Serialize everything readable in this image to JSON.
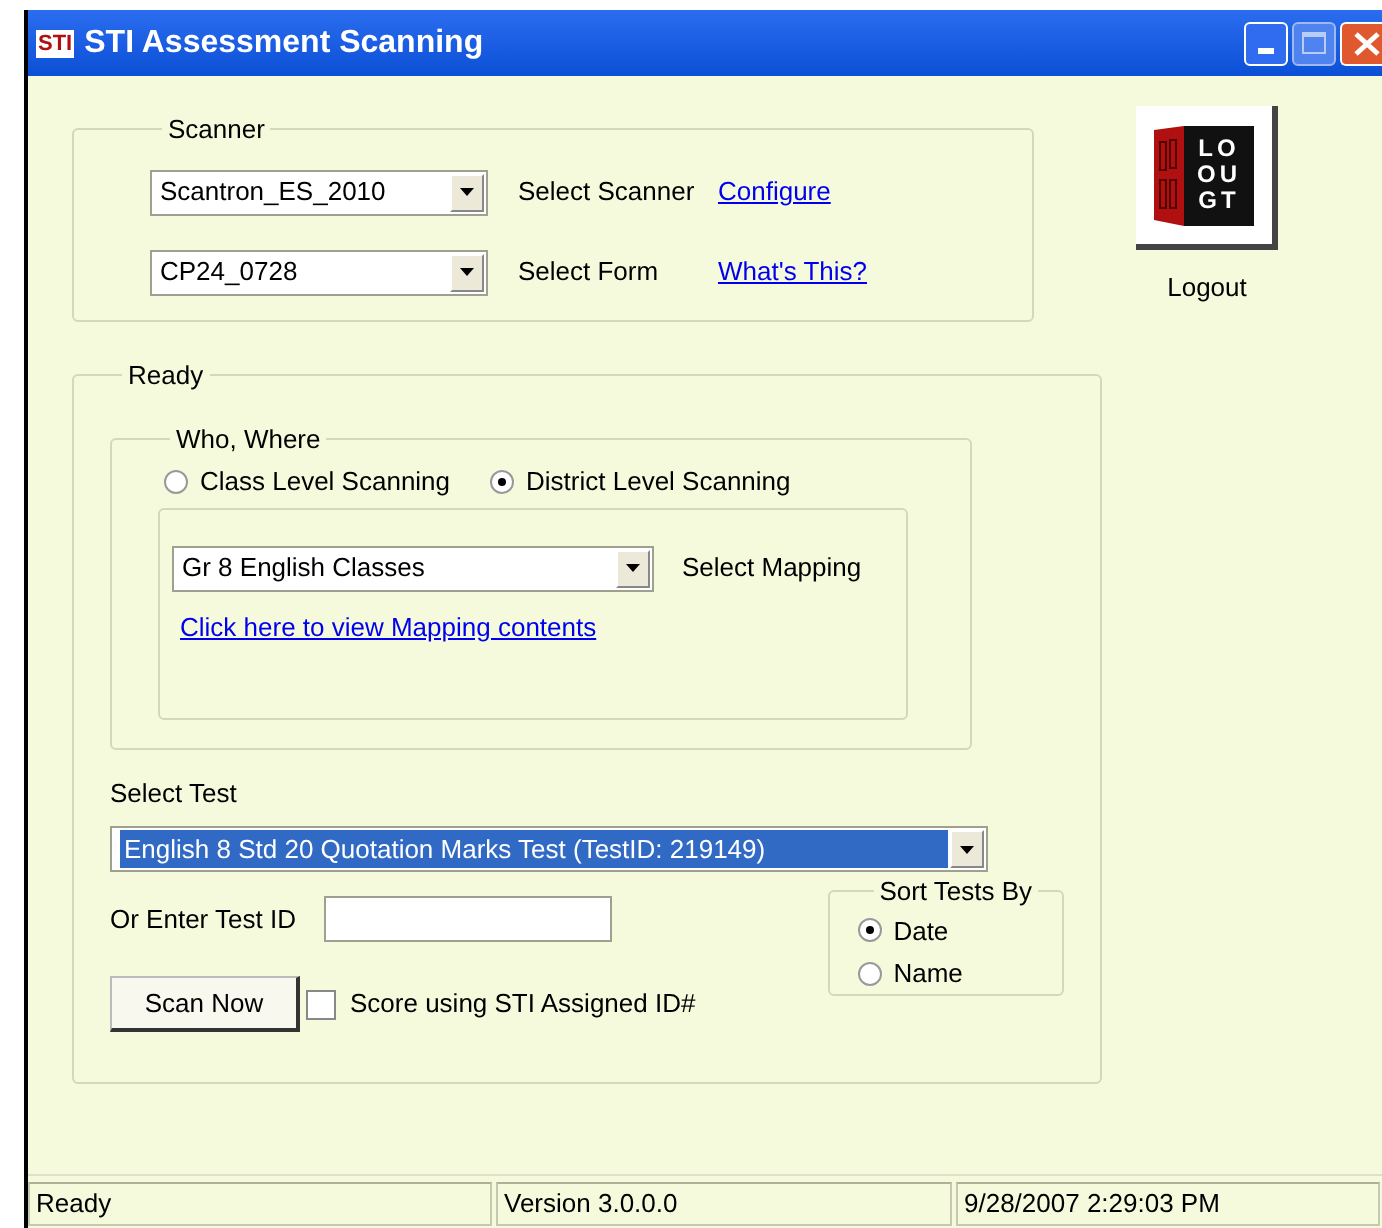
{
  "window": {
    "icon_text": "STI",
    "title": "STI Assessment Scanning"
  },
  "scanner": {
    "title": "Scanner",
    "rows": [
      {
        "value": "Scantron_ES_2010",
        "label": "Select Scanner",
        "link": "Configure"
      },
      {
        "value": "CP24_0728",
        "label": "Select Form",
        "link": "What's This?"
      }
    ]
  },
  "logout": {
    "icon_text": [
      "LO",
      "OU",
      "GT"
    ],
    "label": "Logout"
  },
  "ready": {
    "title": "Ready",
    "who_where": {
      "title": "Who, Where",
      "options": [
        {
          "label": "Class Level Scanning",
          "selected": false
        },
        {
          "label": "District Level Scanning",
          "selected": true
        }
      ],
      "mapping": {
        "value": "Gr 8 English Classes",
        "label": "Select Mapping",
        "link": "Click here to view Mapping contents"
      }
    },
    "select_test": {
      "label": "Select Test",
      "value": "English 8 Std 20 Quotation Marks Test  (TestID: 219149)"
    },
    "test_id": {
      "label": "Or Enter Test ID"
    },
    "sort": {
      "title": "Sort Tests By",
      "options": [
        {
          "label": "Date",
          "selected": true
        },
        {
          "label": "Name",
          "selected": false
        }
      ]
    },
    "scan_button": "Scan Now",
    "score_checkbox": {
      "label": "Score using STI Assigned ID#",
      "checked": false
    }
  },
  "status_bar": [
    "Ready",
    "Version 3.0.0.0",
    "9/28/2007 2:29:03 PM"
  ]
}
